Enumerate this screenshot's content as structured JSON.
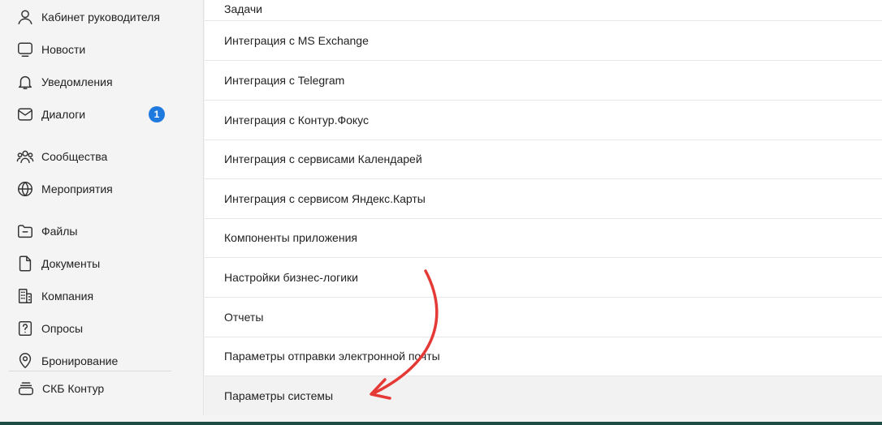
{
  "sidebar": {
    "items": [
      {
        "label": "Кабинет руководителя",
        "icon": "user-icon"
      },
      {
        "label": "Новости",
        "icon": "monitor-icon"
      },
      {
        "label": "Уведомления",
        "icon": "bell-icon"
      },
      {
        "label": "Диалоги",
        "icon": "envelope-icon",
        "badge": "1"
      },
      {
        "label": "Сообщества",
        "icon": "people-icon"
      },
      {
        "label": "Мероприятия",
        "icon": "globe-icon"
      },
      {
        "label": "Файлы",
        "icon": "folder-icon"
      },
      {
        "label": "Документы",
        "icon": "document-icon"
      },
      {
        "label": "Компания",
        "icon": "building-icon"
      },
      {
        "label": "Опросы",
        "icon": "question-icon"
      },
      {
        "label": "Бронирование",
        "icon": "location-pin-icon"
      },
      {
        "label": "СКБ Контур",
        "icon": "stack-icon"
      }
    ]
  },
  "main": {
    "rows": [
      {
        "label": "Задачи"
      },
      {
        "label": "Интеграция с MS Exchange"
      },
      {
        "label": "Интеграция с Telegram"
      },
      {
        "label": "Интеграция с Контур.Фокус"
      },
      {
        "label": "Интеграция с сервисами Календарей"
      },
      {
        "label": "Интеграция с сервисом Яндекс.Карты"
      },
      {
        "label": "Компоненты приложения"
      },
      {
        "label": "Настройки бизнес-логики"
      },
      {
        "label": "Отчеты"
      },
      {
        "label": "Параметры отправки электронной почты"
      },
      {
        "label": "Параметры системы"
      }
    ]
  },
  "colors": {
    "accent": "#1f7ae0",
    "annotation_arrow": "#e53935",
    "highlight_row": "#f2f2f2"
  }
}
